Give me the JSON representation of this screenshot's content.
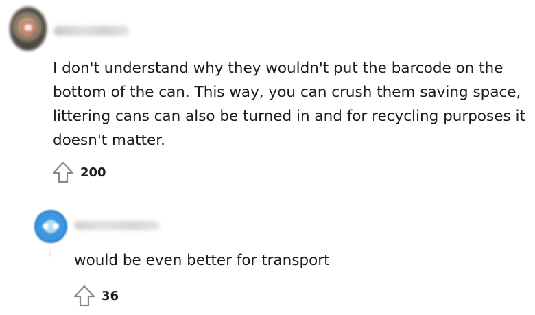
{
  "comments": [
    {
      "text": "I don't understand why they wouldn't put the barcode on the\nbottom of the can. This way, you can crush them saving space,\nlittering cans can also be turned in and for recycling purposes it\ndoesn't matter.",
      "score": "200",
      "avatar_icon": "user-avatar-icon",
      "vote_icon": "upvote-arrow-icon"
    },
    {
      "text": "would be even better for transport",
      "score": "36",
      "avatar_icon": "snoo-avatar-icon",
      "vote_icon": "upvote-arrow-icon"
    }
  ]
}
